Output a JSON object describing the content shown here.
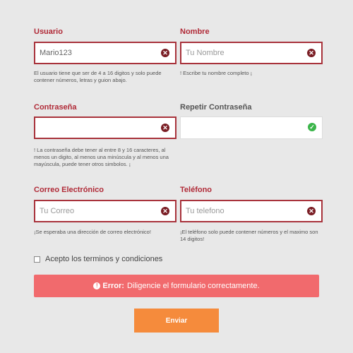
{
  "form": {
    "usuario": {
      "label": "Usuario",
      "value": "Mario123",
      "placeholder": "",
      "help": "El usuario tiene que ser de 4 a 16 digitos y solo puede contener números, letras y guion abajo.",
      "status": "error"
    },
    "nombre": {
      "label": "Nombre",
      "value": "",
      "placeholder": "Tu Nombre",
      "help": "! Escribe tu nombre completo ¡",
      "status": "error"
    },
    "contrasena": {
      "label": "Contraseña",
      "value": "",
      "placeholder": "",
      "help": "! La contraseña debe tener al entre 8 y 16 caracteres, al menos un digito, al menos una minúscula y al menos una mayúscula, puede tener otros simbolos. ¡",
      "status": "error"
    },
    "repetir_contrasena": {
      "label": "Repetir Contraseña",
      "value": "",
      "placeholder": "",
      "status": "ok"
    },
    "correo": {
      "label": "Correo Electrónico",
      "value": "",
      "placeholder": "Tu Correo",
      "help": "¡Se esperaba una dirección de correo electrónico!",
      "status": "error"
    },
    "telefono": {
      "label": "Teléfono",
      "value": "",
      "placeholder": "Tu telefono",
      "help": "¡El teléfono solo puede contener números y el maximo son 14 digitos!",
      "status": "error"
    },
    "terms_label": "Acepto los terminos y condiciones",
    "alert": {
      "title": "Error:",
      "message": "Diligencie el formulario correctamente."
    },
    "submit_label": "Enviar"
  },
  "colors": {
    "error_border": "#a8323b",
    "error_label": "#b02a37",
    "alert_bg": "#f16a6d",
    "button_bg": "#f58b3c",
    "success_icon": "#3bb54a"
  },
  "icons": {
    "error": "times-circle-icon",
    "success": "check-circle-icon",
    "alert": "exclamation-circle-icon"
  }
}
